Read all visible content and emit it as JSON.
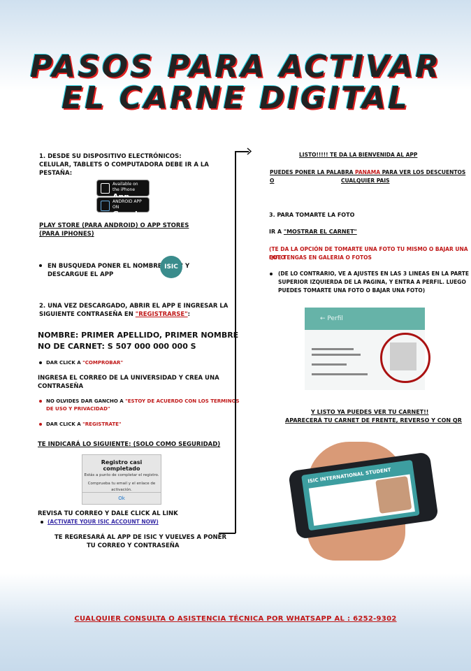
{
  "title": {
    "line1": "PASOS PARA ACTIVAR",
    "line2": "EL CARNE DIGITAL"
  },
  "left": {
    "step1_heading": "1. DESDE SU DISPOSITIVO ELECTRÓNICOS:",
    "step1_text_a": "CELULAR, TABLETS O COMPUTADORA DEBE IR A LA",
    "step1_text_b": "PESTAÑA:",
    "appstore_small": "Available on the iPhone",
    "appstore_big": "App Store",
    "googleplay_small": "ANDROID APP ON",
    "googleplay_big": "Google play",
    "stores_line_a": "PLAY STORE (PARA ANDROID) O APP STORES",
    "stores_line_b": "(PARA IPHONES)",
    "search_a": "EN BUSQUEDA PONER EL NOMBRE \"ISIC\"",
    "search_y": "Y",
    "search_b": "DESCARGUE EL APP",
    "isic_logo": "ISIC",
    "step2_a": "2. UNA VEZ DESCARGADO, ABRIR EL APP E INGRESAR LA",
    "step2_b_pre": "SIGUIENTE CONTRASEÑA EN ",
    "step2_b_red": "\"REGISTRARSE\"",
    "step2_b_post": ":",
    "nombre": "NOMBRE: PRIMER APELLIDO, PRIMER NOMBRE",
    "carnet": "NO DE CARNET: S 507 000 000 000 S",
    "click_pre": "DAR CLICK A ",
    "click_red": "\"COMPROBAR\"",
    "correo_a": "INGRESA EL CORREO DE LA UNIVERSIDAD Y CREA UNA",
    "correo_b": "CONTRASEÑA",
    "gancho_pre": "NO OLVIDES DAR GANCHO A ",
    "gancho_red_a": "\"ESTOY DE ACUERDO CON LOS TERMINOS",
    "gancho_red_b": "DE USO Y PRIVACIDAD\"",
    "registrate_pre": "DAR CLICK A ",
    "registrate_red": "\"REGISTRATE\"",
    "indicara": "TE INDICARÁ LO SIGUIENTE: (SOLO COMO SEGURIDAD)",
    "dialog_title": "Registro casi completado",
    "dialog_sub": "Estás a punto de completar el registro.",
    "dialog_body_a": "Comprueba tu email y el enlace de",
    "dialog_body_b": "activación.",
    "dialog_ok": "Ok",
    "revisa": "REVISA TU CORREO Y DALE CLICK AL LINK",
    "activate_link": "(ACTIVATE YOUR ISIC ACCOUNT NOW)",
    "regresara_a": "TE REGRESARÁ AL APP DE ISIC Y VUELVES A PONER",
    "regresara_b": "TU CORREO Y CONTRASEÑA"
  },
  "right": {
    "listo": "LISTO!!!!! TE DA LA BIENVENIDA AL APP",
    "panama_pre": "PUEDES PONER LA PALABRA ",
    "panama_red": "PANAMA",
    "panama_post": " PARA VER LOS DESCUENTOS O",
    "panama_b": "CUALQUIER PAIS",
    "step3": "3. PARA TOMARTE LA FOTO",
    "mostrar_pre": "IR A ",
    "mostrar": "\"MOSTRAR EL CARNET\"",
    "opcion_a": "(TE DA LA OPCIÓN DE TOMARTE UNA FOTO TU MISMO O BAJAR UNA FOTO",
    "opcion_b": "QUE TENGAS EN GALERIA O FOTOS",
    "contrario_a": "(DE LO CONTRARIO, VE A AJUSTES EN LAS 3 LINEAS EN LA PARTE",
    "contrario_b": "SUPERIOR IZQUIERDA DE LA PAGINA, Y ENTRA A PERFIL. LUEGO",
    "contrario_c": "PUEDES TOMARTE UNA FOTO O BAJAR UNA FOTO)",
    "perfil_bar": "Perfil",
    "listo_ver": "Y LISTO YA PUEDES VER TU CARNET!!",
    "aparecera": "APARECERÁ TU CARNET DE FRENTE, REVERSO Y CON QR",
    "card_label": "ISIC INTERNATIONAL STUDENT"
  },
  "footer": "CUALQUIER CONSULTA O ASISTENCIA TÉCNICA POR WHATSAPP AL : 6252-9302"
}
